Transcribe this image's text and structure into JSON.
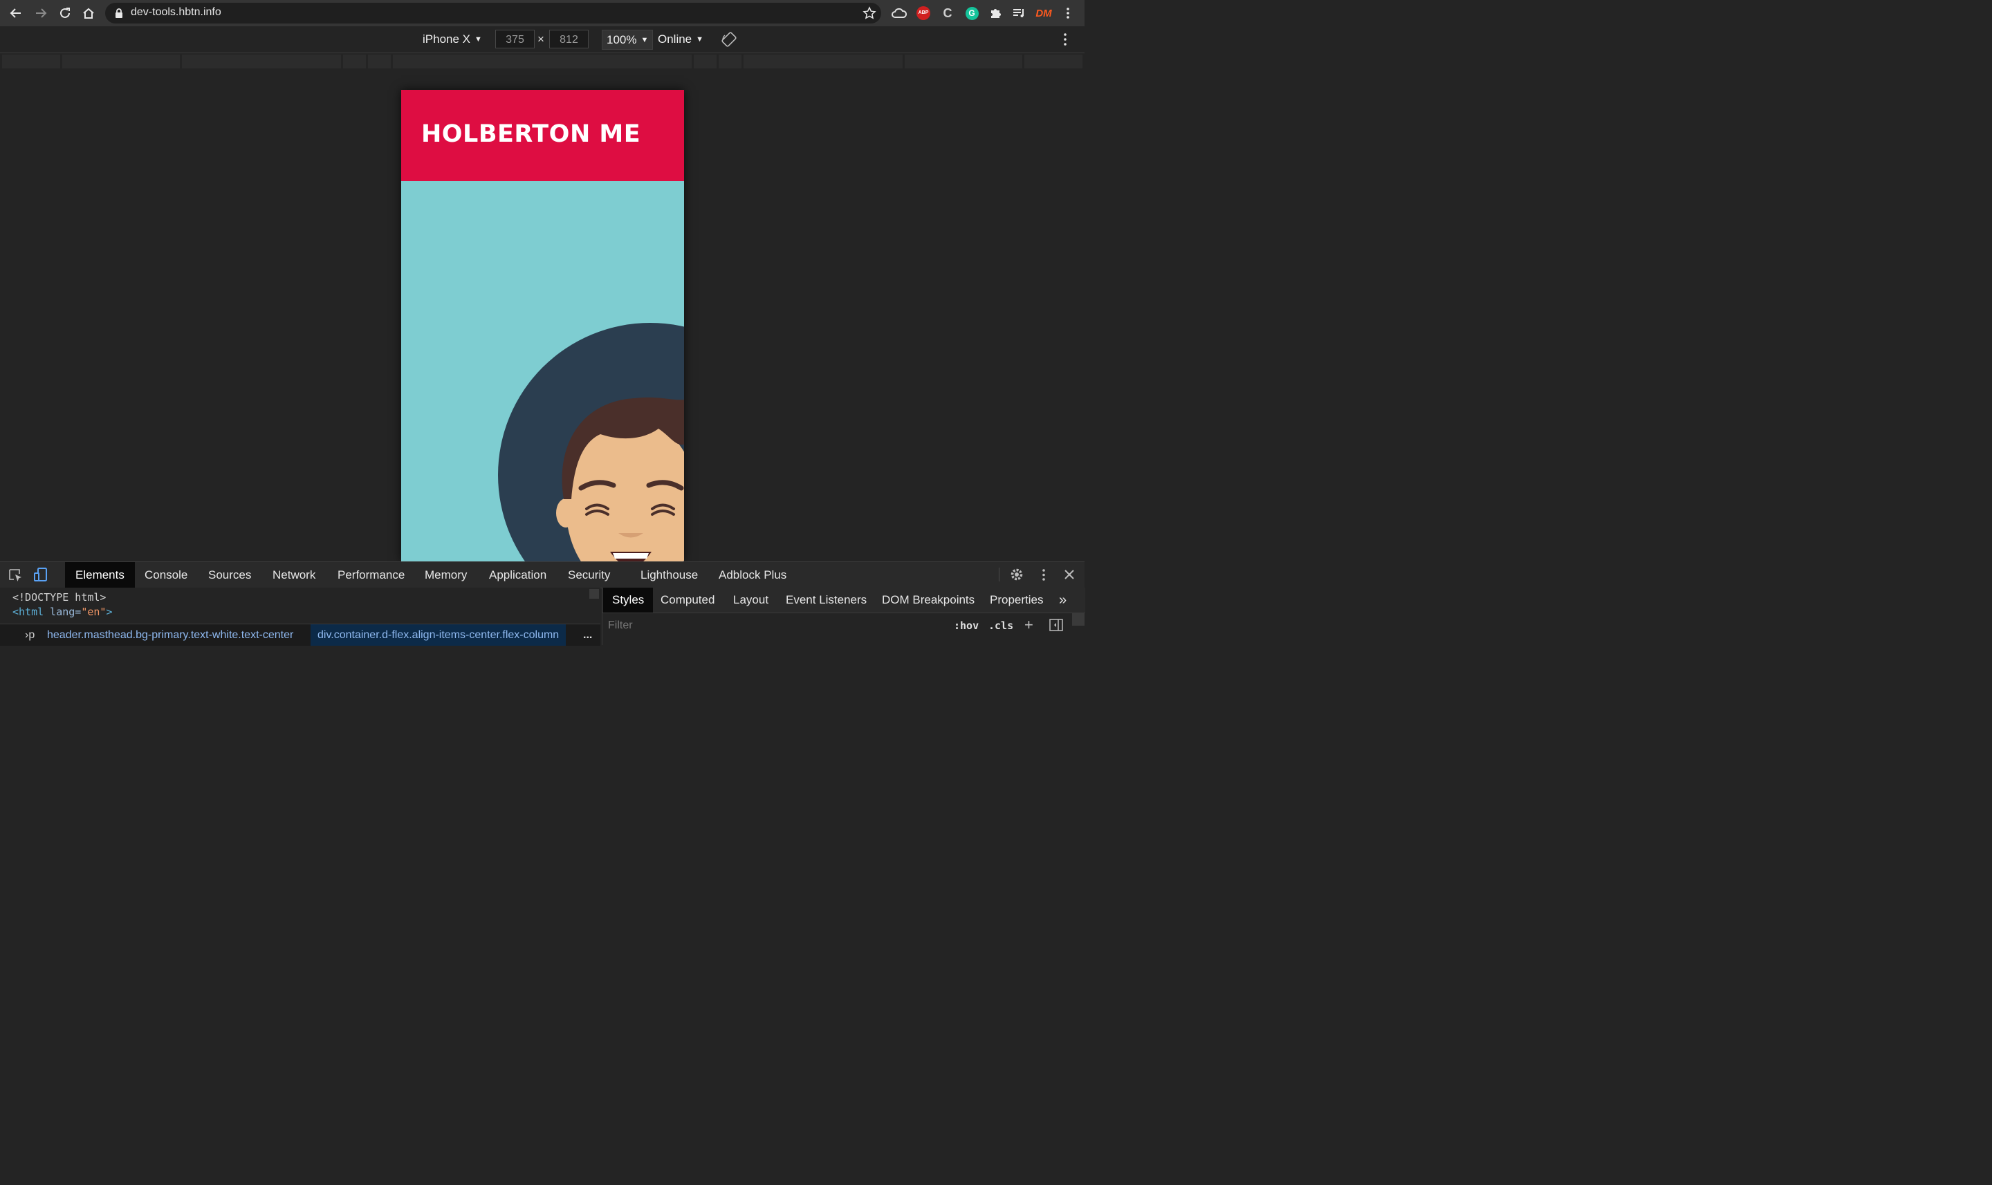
{
  "browser": {
    "url": "dev-tools.hbtn.info",
    "extensions": [
      "cloud-icon",
      "abp-icon",
      "c-icon",
      "grammarly-icon",
      "puzzle-icon",
      "media-icon",
      "dm-icon"
    ],
    "abp_label": "ABP",
    "dm_label": "DM",
    "grammarly_label": "G",
    "c_label": "C"
  },
  "device_toolbar": {
    "device": "iPhone X",
    "width": "375",
    "height": "812",
    "times": "×",
    "zoom": "100%",
    "network": "Online"
  },
  "page": {
    "title": "HOLBERTON ME",
    "colors": {
      "primary": "#de0d42",
      "background": "#7ecdd1",
      "circle": "#2b3e50"
    }
  },
  "devtools": {
    "tabs": [
      "Elements",
      "Console",
      "Sources",
      "Network",
      "Performance",
      "Memory",
      "Application",
      "Security",
      "Lighthouse",
      "Adblock Plus"
    ],
    "active_tab": "Elements",
    "code": {
      "line1": "<!DOCTYPE html>",
      "line2_tag_open": "<html",
      "line2_attr": " lang=",
      "line2_value": "\"en\"",
      "line2_close": ">"
    },
    "breadcrumbs": {
      "partial": "›p",
      "header": "header.masthead.bg-primary.text-white.text-center",
      "div": "div.container.d-flex.align-items-center.flex-column",
      "more": "..."
    },
    "side_tabs": [
      "Styles",
      "Computed",
      "Layout",
      "Event Listeners",
      "DOM Breakpoints",
      "Properties"
    ],
    "active_side_tab": "Styles",
    "more_tabs": "»",
    "filter_placeholder": "Filter",
    "hov": ":hov",
    "cls": ".cls",
    "plus": "+"
  }
}
